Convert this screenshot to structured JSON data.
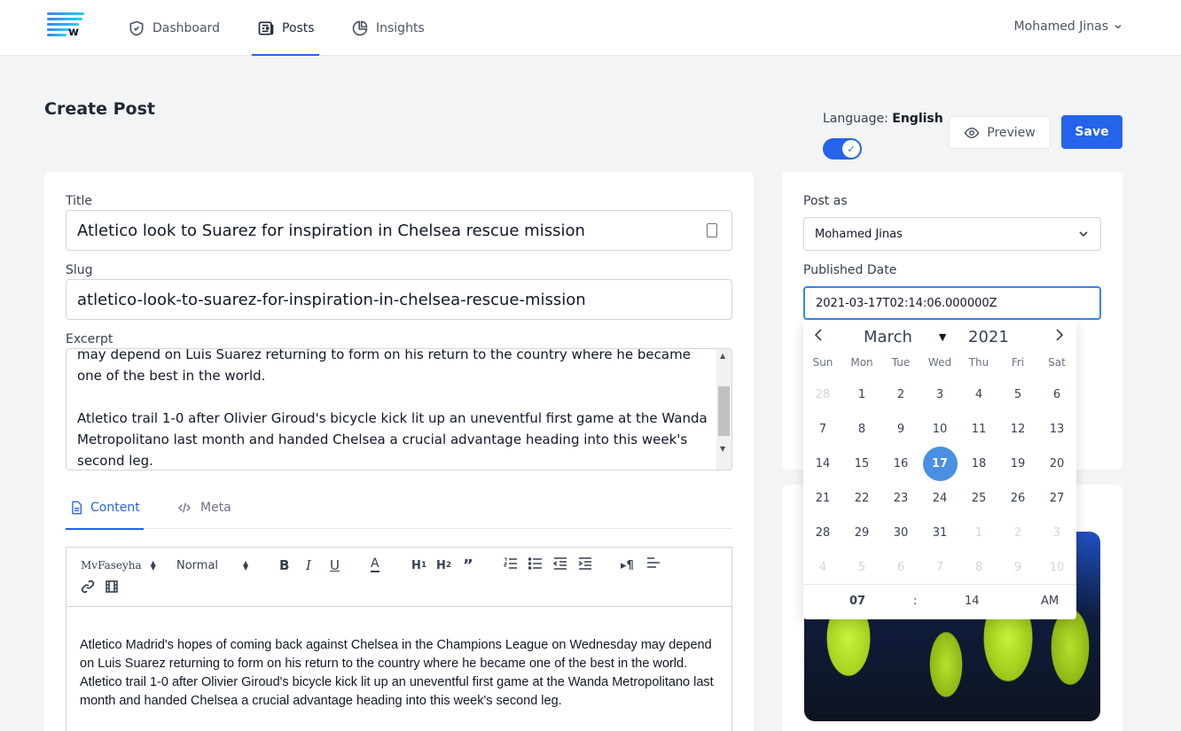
{
  "nav": {
    "items": [
      {
        "label": "Dashboard",
        "icon": "shield-check-icon"
      },
      {
        "label": "Posts",
        "icon": "newspaper-icon"
      },
      {
        "label": "Insights",
        "icon": "pie-chart-icon"
      }
    ],
    "active": "Posts",
    "user_name": "Mohamed Jinas"
  },
  "page": {
    "title": "Create Post",
    "language_label": "Language:",
    "language_value": "English",
    "language_toggle_on": true,
    "preview_label": "Preview",
    "save_label": "Save"
  },
  "form": {
    "title_label": "Title",
    "title_value": "Atletico look to Suarez for inspiration in Chelsea rescue mission",
    "slug_label": "Slug",
    "slug_value": "atletico-look-to-suarez-for-inspiration-in-chelsea-rescue-mission",
    "excerpt_label": "Excerpt",
    "excerpt_p1": "may depend on Luis Suarez returning to form on his return to the country where he became one of the best in the world.",
    "excerpt_p2": "Atletico trail 1-0 after Olivier Giroud's bicycle kick lit up an uneventful first game at the Wanda Metropolitano last month and handed Chelsea a crucial advantage heading into this week's second leg."
  },
  "tabs": [
    {
      "label": "Content",
      "active": true
    },
    {
      "label": "Meta",
      "active": false
    }
  ],
  "editor": {
    "font_select": "MvFaseyha",
    "size_select": "Normal",
    "content_line1": "Atletico Madrid's hopes of coming back against Chelsea in the Champions League on Wednesday may depend on Luis Suarez returning to form on his return to the country where he became one of the best in the world.",
    "content_line2": "Atletico trail 1-0 after Olivier Giroud's bicycle kick lit up an uneventful first game at the Wanda Metropolitano last month and handed Chelsea a crucial advantage heading into this week's second leg."
  },
  "sidebar": {
    "post_as_label": "Post as",
    "post_as_value": "Mohamed Jinas",
    "published_label": "Published Date",
    "published_value": "2021-03-17T02:14:06.000000Z"
  },
  "datepicker": {
    "month": "March",
    "year": "2021",
    "weekdays": [
      "Sun",
      "Mon",
      "Tue",
      "Wed",
      "Thu",
      "Fri",
      "Sat"
    ],
    "weeks": [
      [
        "28",
        "1",
        "2",
        "3",
        "4",
        "5",
        "6"
      ],
      [
        "7",
        "8",
        "9",
        "10",
        "11",
        "12",
        "13"
      ],
      [
        "14",
        "15",
        "16",
        "17",
        "18",
        "19",
        "20"
      ],
      [
        "21",
        "22",
        "23",
        "24",
        "25",
        "26",
        "27"
      ],
      [
        "28",
        "29",
        "30",
        "31",
        "1",
        "2",
        "3"
      ],
      [
        "4",
        "5",
        "6",
        "7",
        "8",
        "9",
        "10"
      ]
    ],
    "selected_day": "17",
    "hour": "07",
    "separator": ":",
    "minute": "14",
    "ampm": "AM"
  },
  "colors": {
    "primary": "#2563eb",
    "selected_day": "#4a90e2"
  }
}
